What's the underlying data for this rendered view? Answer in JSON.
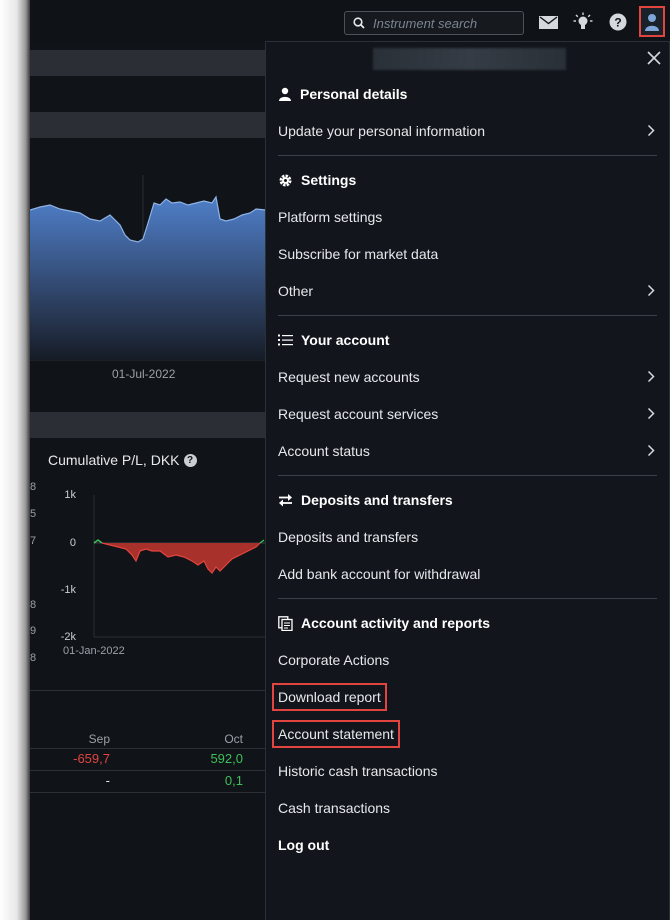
{
  "header": {
    "search_placeholder": "Instrument search",
    "icons": [
      "search-icon",
      "mail-icon",
      "lightbulb-icon",
      "help-icon",
      "user-icon"
    ]
  },
  "background": {
    "chart_date_label": "01-Jul-2022",
    "pl_title": "Cumulative P/L, DKK",
    "pl_y_labels": [
      "1k",
      "0",
      "-1k",
      "-2k"
    ],
    "pl_x_label": "01-Jan-2022",
    "cut_digits": [
      "8",
      "5",
      "7",
      "8",
      "9",
      "8"
    ],
    "table": {
      "columns": [
        "Sep",
        "Oct"
      ],
      "rows": [
        [
          "-659,7",
          "592,0"
        ],
        [
          "-",
          "0,1"
        ]
      ]
    }
  },
  "menu": {
    "sections": [
      {
        "title": "Personal details",
        "icon": "person-icon",
        "items": [
          {
            "label": "Update your personal information",
            "chevron": true
          }
        ]
      },
      {
        "title": "Settings",
        "icon": "gear-icon",
        "items": [
          {
            "label": "Platform settings",
            "chevron": false
          },
          {
            "label": "Subscribe for market data",
            "chevron": false
          },
          {
            "label": "Other",
            "chevron": true
          }
        ]
      },
      {
        "title": "Your account",
        "icon": "list-icon",
        "items": [
          {
            "label": "Request new accounts",
            "chevron": true
          },
          {
            "label": "Request account services",
            "chevron": true
          },
          {
            "label": "Account status",
            "chevron": true
          }
        ]
      },
      {
        "title": "Deposits and transfers",
        "icon": "transfer-icon",
        "items": [
          {
            "label": "Deposits and transfers",
            "chevron": false
          },
          {
            "label": "Add bank account for withdrawal",
            "chevron": false
          }
        ]
      },
      {
        "title": "Account activity and reports",
        "icon": "reports-icon",
        "items": [
          {
            "label": "Corporate Actions",
            "chevron": false
          },
          {
            "label": "Download report",
            "chevron": false,
            "highlighted": true
          },
          {
            "label": "Account statement",
            "chevron": false,
            "highlighted": true
          },
          {
            "label": "Historic cash transactions",
            "chevron": false
          },
          {
            "label": "Cash transactions",
            "chevron": false
          }
        ]
      }
    ],
    "logout": "Log out"
  },
  "colors": {
    "background": "#101317",
    "menu_background": "#12161c",
    "highlight": "#e2453f",
    "positive": "#3fbf5a",
    "negative": "#e2453f",
    "chart_fill": "#4a7ac4"
  }
}
